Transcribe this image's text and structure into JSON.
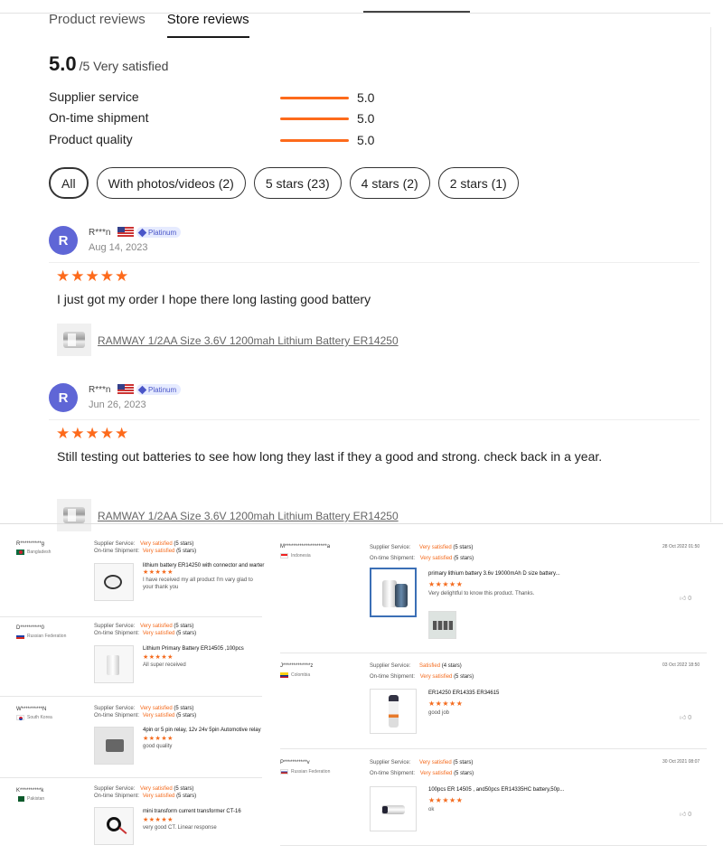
{
  "tabs": [
    "Product reviews",
    "Store reviews"
  ],
  "summary": {
    "score": "5.0",
    "suffix": "/5 Very satisfied"
  },
  "metrics": [
    {
      "label": "Supplier service",
      "value": "5.0",
      "fill": 1.0
    },
    {
      "label": "On-time shipment",
      "value": "5.0",
      "fill": 1.0
    },
    {
      "label": "Product quality",
      "value": "5.0",
      "fill": 1.0
    }
  ],
  "filters": [
    "All",
    "With photos/videos (2)",
    "5 stars (23)",
    "4 stars (2)",
    "2 stars (1)"
  ],
  "reviews": [
    {
      "initial": "R",
      "name": "R***n",
      "badge": "Platinum",
      "date": "Aug 14, 2023",
      "stars": "★★★★★",
      "text": "I just got my order I hope there long lasting good battery",
      "product": "RAMWAY 1/2AA Size 3.6V 1200mah Lithium Battery ER14250"
    },
    {
      "initial": "R",
      "name": "R***n",
      "badge": "Platinum",
      "date": "Jun 26, 2023",
      "stars": "★★★★★",
      "text": "Still testing out batteries to see how long they last if they a good and strong. check back in a year.",
      "product": "RAMWAY 1/2AA Size 3.6V 1200mah Lithium Battery ER14250"
    }
  ],
  "labels": {
    "supplier": "Supplier Service:",
    "shipment": "On-time Shipment:",
    "stars5": "(5 stars)",
    "stars4": "(4 stars)"
  },
  "left_panel": [
    {
      "name": "R**********g",
      "country": "Bangladesh",
      "flag": "#0a6a3d",
      "s1": "Very satisfied",
      "s2": "Very satisfied",
      "title": "lithium battery ER14250 with connector and warter",
      "comment": "I have received  my all product I'm vary glad to your thank you"
    },
    {
      "name": "D**********0",
      "country": "Russian Federation",
      "flag": "ru",
      "s1": "Very satisfied",
      "s2": "Very satisfied",
      "title": "Lithium Primary Battery ER14505 ,100pcs",
      "comment": "All super received"
    },
    {
      "name": "W**********N",
      "country": "South Korea",
      "flag": "kr",
      "s1": "Very satisfied",
      "s2": "Very satisfied",
      "title": "4pin or 5 pin relay, 12v 24v 5pin Automotive relay",
      "comment": "good quality"
    },
    {
      "name": "K**********k",
      "country": "Pakistan",
      "flag": "#0c5a2b",
      "s1": "Very satisfied",
      "s2": "Very satisfied",
      "title": "mini transform current transformer CT-16",
      "comment": "very good CT. Linear response"
    }
  ],
  "right_panel": [
    {
      "name": "M********************a",
      "country": "Indonesia",
      "flag": "id",
      "s1": "Very satisfied",
      "s1stars": "(5 stars)",
      "s2": "Very satisfied",
      "date": "28 Oct 2022 01:50",
      "title": "primary lithium battery 3.6v 19000mAh D size battery...",
      "comment": "Very delightful to know this product. Thanks.",
      "likes": "0"
    },
    {
      "name": "J*************z",
      "country": "Colombia",
      "flag": "co",
      "s1": "Satisfied",
      "s1stars": "(4 stars)",
      "s2": "Very satisfied",
      "date": "03 Oct 2022 18:50",
      "title": "ER14250 ER14335 ER34615",
      "comment": "good job",
      "likes": "0"
    },
    {
      "name": "P***********v",
      "country": "Russian Federation",
      "flag": "ru",
      "s1": "Very satisfied",
      "s1stars": "(5 stars)",
      "s2": "Very satisfied",
      "date": "30 Oct 2021 08:07",
      "title": "100pcs ER 14505 , and50pcs ER14335HC battery,50p...",
      "comment": "ok",
      "likes": "0"
    }
  ],
  "star_row": "★★★★★"
}
